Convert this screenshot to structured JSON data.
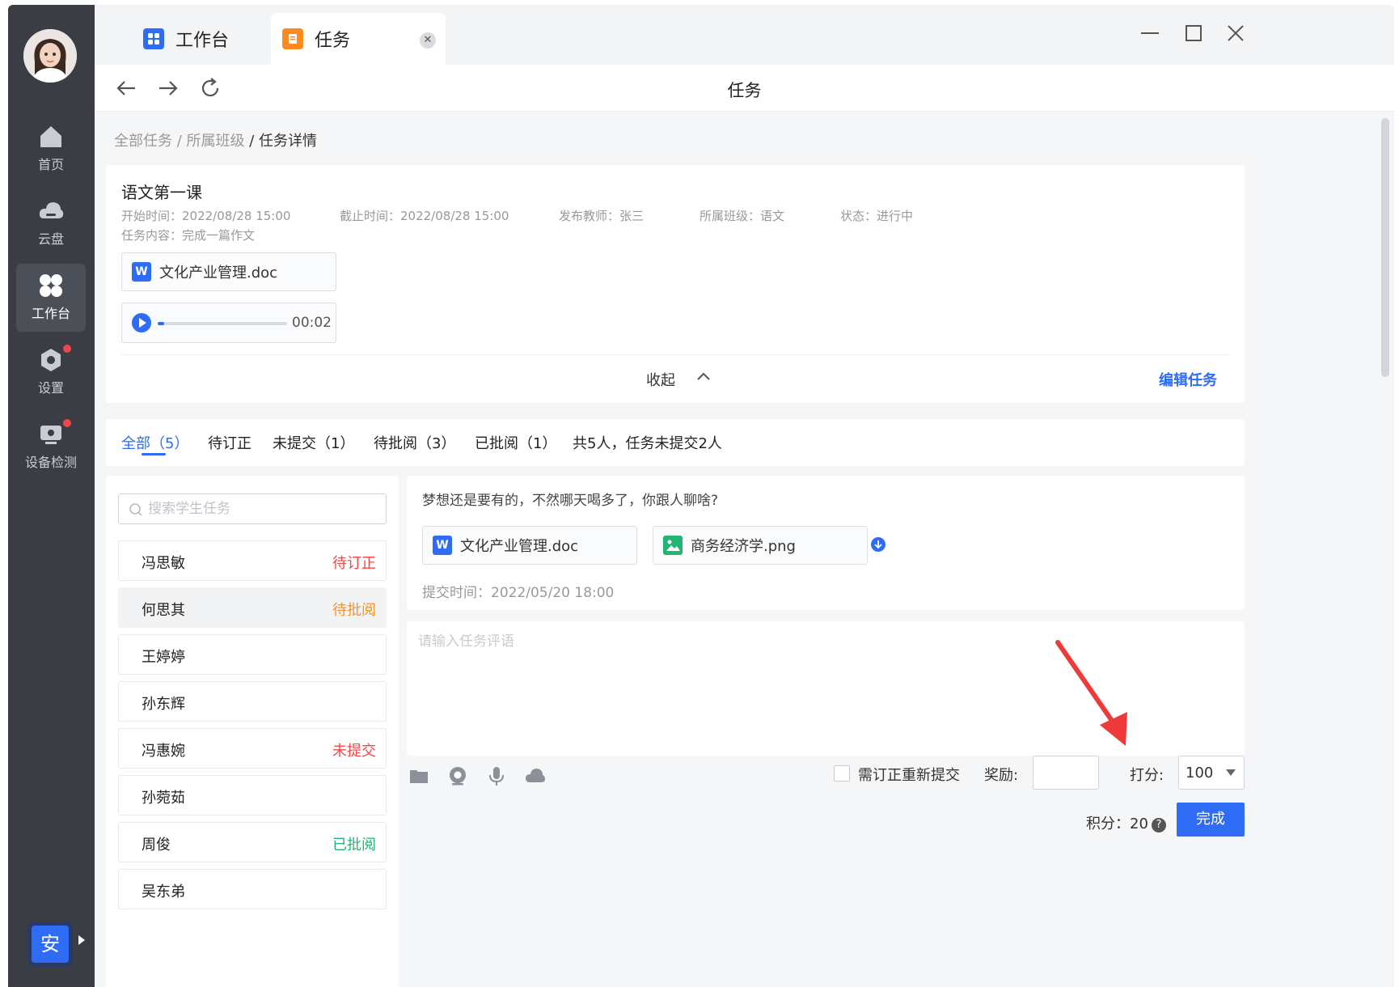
{
  "colors": {
    "accent": "#2f6cf6",
    "sidebar": "#3a3d44",
    "pending_fix": "#f04848",
    "pending_review": "#f5932b",
    "reviewed": "#22b573",
    "annotation_arrow": "#f03a3a"
  },
  "sidebar": {
    "avatar_icon": "user-avatar",
    "items": [
      {
        "label": "首页",
        "icon": "home-icon"
      },
      {
        "label": "云盘",
        "icon": "cloud-icon"
      },
      {
        "label": "工作台",
        "icon": "workbench-icon",
        "active": true
      },
      {
        "label": "设置",
        "icon": "settings-icon",
        "badge": true
      },
      {
        "label": "设备检测",
        "icon": "device-check-icon",
        "badge": true
      }
    ],
    "lang_badge": "安"
  },
  "tabs": [
    {
      "label": "工作台",
      "icon": "workbench-app-icon"
    },
    {
      "label": "任务",
      "icon": "task-app-icon",
      "active": true
    }
  ],
  "toolbar": {
    "title": "任务"
  },
  "breadcrumb": {
    "items": [
      "全部任务",
      "所属班级"
    ],
    "separator": " / ",
    "current": "任务详情"
  },
  "task": {
    "title": "语文第一课",
    "start": "开始时间：2022/08/28 15:00",
    "end": "截止时间：2022/08/28 15:00",
    "teacher": "发布教师：张三",
    "class": "所属班级：语文",
    "status": "状态：进行中",
    "content": "任务内容：完成一篇作文",
    "file": "文化产业管理.doc",
    "audio_time": "00:02",
    "audio_progress": 0.05,
    "collapse": "收起",
    "edit": "编辑任务"
  },
  "filters": {
    "tabs": [
      "全部（5）",
      "待订正",
      "未提交（1）",
      "待批阅（3）",
      "已批阅（1）"
    ],
    "summary": "共5人，任务未提交2人"
  },
  "search": {
    "placeholder": "搜索学生任务"
  },
  "students": [
    {
      "name": "冯思敏",
      "status": "待订正",
      "color": "#f04848"
    },
    {
      "name": "何思其",
      "status": "待批阅",
      "color": "#f5932b",
      "selected": true
    },
    {
      "name": "王婷婷",
      "status": ""
    },
    {
      "name": "孙东辉",
      "status": ""
    },
    {
      "name": "冯惠婉",
      "status": "未提交",
      "color": "#f04848"
    },
    {
      "name": "孙菀茹",
      "status": ""
    },
    {
      "name": "周俊",
      "status": "已批阅",
      "color": "#22b573"
    },
    {
      "name": "吴东弟",
      "status": ""
    }
  ],
  "submission": {
    "text": "梦想还是要有的，不然哪天喝多了，你跟人聊啥?",
    "files": [
      "文化产业管理.doc",
      "商务经济学.png"
    ],
    "time": "提交时间：2022/05/20 18:00"
  },
  "comment": {
    "placeholder": "请输入任务评语",
    "tool_icons": [
      "folder-icon",
      "camera-icon",
      "microphone-icon",
      "cloud-upload-icon"
    ],
    "resubmit_label": "需订正重新提交",
    "reward_label": "奖励:",
    "score_label": "打分:",
    "score_value": "100",
    "points": "积分：20",
    "done": "完成"
  }
}
